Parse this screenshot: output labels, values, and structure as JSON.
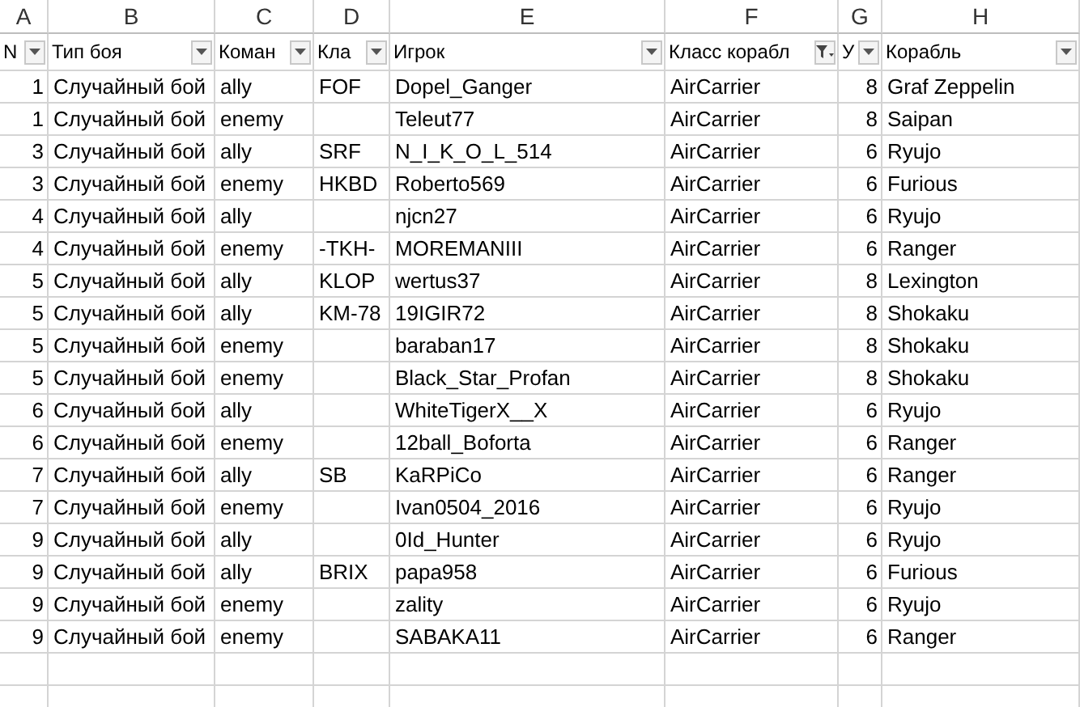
{
  "column_letters": [
    "A",
    "B",
    "C",
    "D",
    "E",
    "F",
    "G",
    "H"
  ],
  "headers": [
    {
      "label": "N",
      "filtered": false
    },
    {
      "label": "Тип боя",
      "filtered": false
    },
    {
      "label": "Коман",
      "filtered": false
    },
    {
      "label": "Кла",
      "filtered": false
    },
    {
      "label": "Игрок",
      "filtered": false
    },
    {
      "label": "Класс корабл",
      "filtered": true
    },
    {
      "label": "У",
      "filtered": false
    },
    {
      "label": "Корабль",
      "filtered": false
    }
  ],
  "rows": [
    [
      "1",
      "Случайный бой",
      "ally",
      "FOF",
      "Dopel_Ganger",
      "AirCarrier",
      "8",
      "Graf Zeppelin"
    ],
    [
      "1",
      "Случайный бой",
      "enemy",
      null,
      "Teleut77",
      "AirCarrier",
      "8",
      "Saipan"
    ],
    [
      "3",
      "Случайный бой",
      "ally",
      "SRF",
      "N_I_K_O_L_514",
      "AirCarrier",
      "6",
      "Ryujo"
    ],
    [
      "3",
      "Случайный бой",
      "enemy",
      "HKBD",
      "Roberto569",
      "AirCarrier",
      "6",
      "Furious"
    ],
    [
      "4",
      "Случайный бой",
      "ally",
      null,
      "njcn27",
      "AirCarrier",
      "6",
      "Ryujo"
    ],
    [
      "4",
      "Случайный бой",
      "enemy",
      "-TKH-",
      "MOREMANIII",
      "AirCarrier",
      "6",
      "Ranger"
    ],
    [
      "5",
      "Случайный бой",
      "ally",
      "KLOP",
      "wertus37",
      "AirCarrier",
      "8",
      "Lexington"
    ],
    [
      "5",
      "Случайный бой",
      "ally",
      "KM-78",
      "19IGIR72",
      "AirCarrier",
      "8",
      "Shokaku"
    ],
    [
      "5",
      "Случайный бой",
      "enemy",
      null,
      "baraban17",
      "AirCarrier",
      "8",
      "Shokaku"
    ],
    [
      "5",
      "Случайный бой",
      "enemy",
      null,
      "Black_Star_Profan",
      "AirCarrier",
      "8",
      "Shokaku"
    ],
    [
      "6",
      "Случайный бой",
      "ally",
      null,
      "WhiteTigerX__X",
      "AirCarrier",
      "6",
      "Ryujo"
    ],
    [
      "6",
      "Случайный бой",
      "enemy",
      null,
      "12ball_Boforta",
      "AirCarrier",
      "6",
      "Ranger"
    ],
    [
      "7",
      "Случайный бой",
      "ally",
      "SB",
      "KaRPiCo",
      "AirCarrier",
      "6",
      "Ranger"
    ],
    [
      "7",
      "Случайный бой",
      "enemy",
      null,
      "Ivan0504_2016",
      "AirCarrier",
      "6",
      "Ryujo"
    ],
    [
      "9",
      "Случайный бой",
      "ally",
      null,
      "0Id_Hunter",
      "AirCarrier",
      "6",
      "Ryujo"
    ],
    [
      "9",
      "Случайный бой",
      "ally",
      "BRIX",
      "papa958",
      "AirCarrier",
      "6",
      "Furious"
    ],
    [
      "9",
      "Случайный бой",
      "enemy",
      null,
      "zality",
      "AirCarrier",
      "6",
      "Ryujo"
    ],
    [
      "9",
      "Случайный бой",
      "enemy",
      null,
      "SABAKA11",
      "AirCarrier",
      "6",
      "Ranger"
    ]
  ]
}
